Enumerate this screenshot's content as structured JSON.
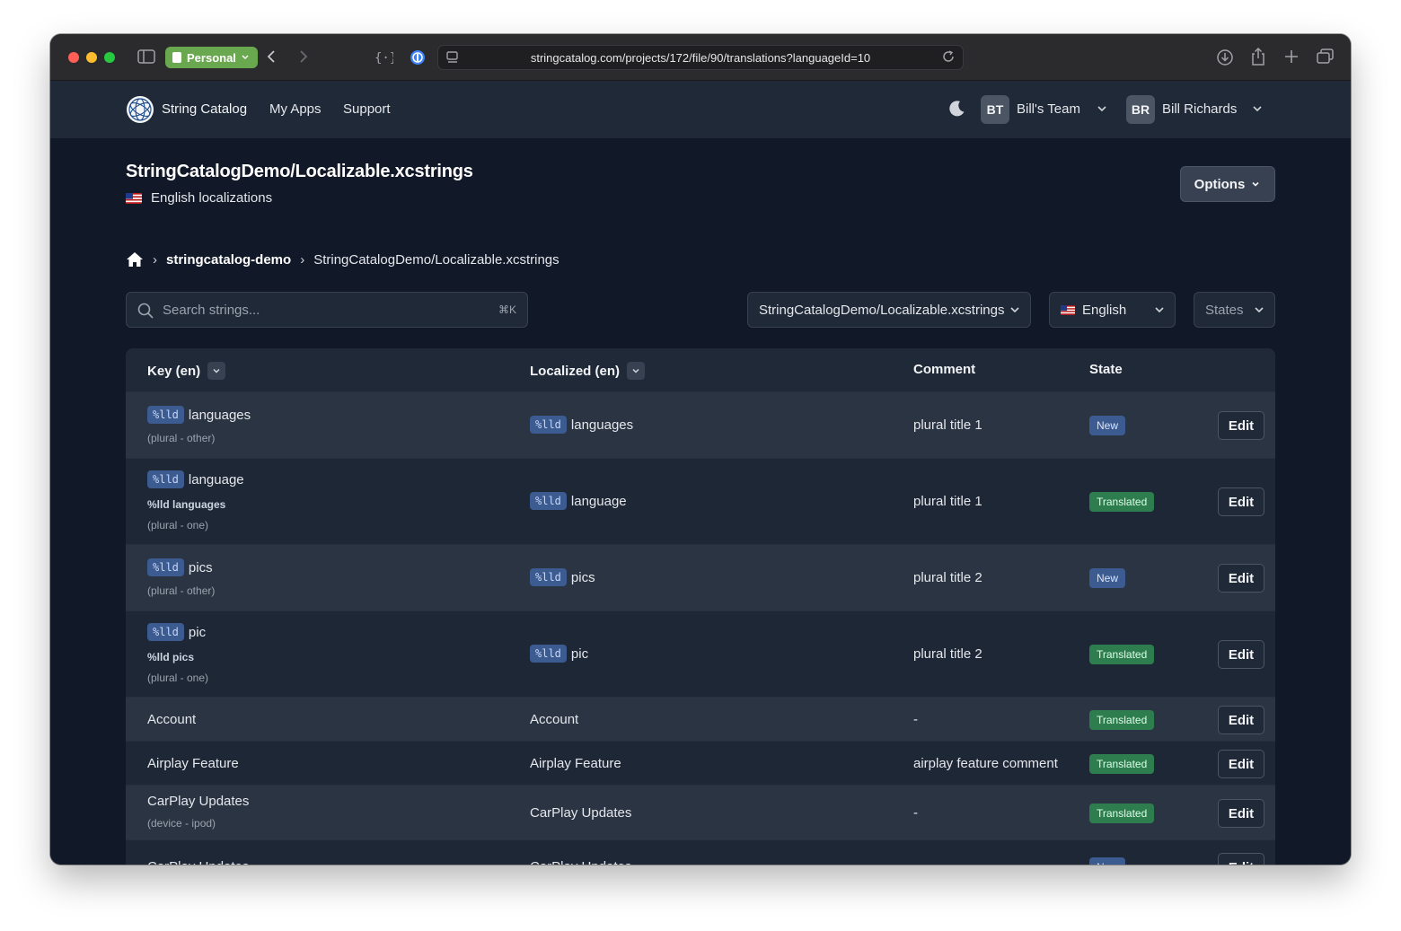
{
  "browser": {
    "profile": "Personal",
    "url": "stringcatalog.com/projects/172/file/90/translations?languageId=10"
  },
  "nav": {
    "brand": "String Catalog",
    "links": [
      "My Apps",
      "Support"
    ],
    "team": {
      "initials": "BT",
      "name": "Bill's Team"
    },
    "user": {
      "initials": "BR",
      "name": "Bill Richards"
    }
  },
  "page": {
    "title": "StringCatalogDemo/Localizable.xcstrings",
    "subtitle": "English localizations",
    "options_label": "Options"
  },
  "breadcrumb": {
    "project": "stringcatalog-demo",
    "file": "StringCatalogDemo/Localizable.xcstrings"
  },
  "filters": {
    "search_placeholder": "Search strings...",
    "search_shortcut": "⌘K",
    "file_select": "StringCatalogDemo/Localizable.xcstrings",
    "language_select": "English",
    "states_select": "States"
  },
  "table": {
    "headers": {
      "key": "Key (en)",
      "localized": "Localized (en)",
      "comment": "Comment",
      "state": "State"
    },
    "edit_label": "Edit",
    "rows": [
      {
        "key_token": "%lld",
        "key_text": "languages",
        "key_sub": "",
        "key_variant": "(plural - other)",
        "loc_token": "%lld",
        "loc_text": "languages",
        "comment": "plural title 1",
        "state": "New"
      },
      {
        "key_token": "%lld",
        "key_text": "language",
        "key_sub": "%lld languages",
        "key_variant": "(plural - one)",
        "loc_token": "%lld",
        "loc_text": "language",
        "comment": "plural title 1",
        "state": "Translated"
      },
      {
        "key_token": "%lld",
        "key_text": "pics",
        "key_sub": "",
        "key_variant": "(plural - other)",
        "loc_token": "%lld",
        "loc_text": "pics",
        "comment": "plural title 2",
        "state": "New"
      },
      {
        "key_token": "%lld",
        "key_text": "pic",
        "key_sub": "%lld pics",
        "key_variant": "(plural - one)",
        "loc_token": "%lld",
        "loc_text": "pic",
        "comment": "plural title 2",
        "state": "Translated"
      },
      {
        "key_token": "",
        "key_text": "Account",
        "key_sub": "",
        "key_variant": "",
        "loc_token": "",
        "loc_text": "Account",
        "comment": "-",
        "state": "Translated"
      },
      {
        "key_token": "",
        "key_text": "Airplay Feature",
        "key_sub": "",
        "key_variant": "",
        "loc_token": "",
        "loc_text": "Airplay Feature",
        "comment": "airplay feature comment",
        "state": "Translated"
      },
      {
        "key_token": "",
        "key_text": "CarPlay Updates",
        "key_sub": "",
        "key_variant": "(device - ipod)",
        "loc_token": "",
        "loc_text": "CarPlay Updates",
        "comment": "-",
        "state": "Translated"
      },
      {
        "key_token": "",
        "key_text": "CarPlay Updates",
        "key_sub": "",
        "key_variant": "",
        "loc_token": "",
        "loc_text": "CarPlay Updates",
        "comment": "-",
        "state": "New"
      }
    ]
  }
}
